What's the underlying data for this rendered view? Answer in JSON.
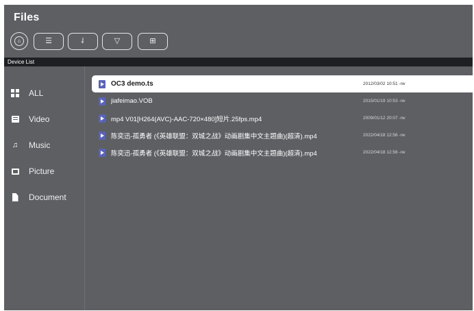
{
  "app": {
    "title": "Files"
  },
  "toolbar": {
    "home_glyph": "⌂",
    "list_glyph": "☰",
    "sort_glyph": "⇃",
    "filter_glyph": "▽",
    "grid_glyph": "⊞"
  },
  "section": {
    "label": "Device List"
  },
  "sidebar": {
    "items": [
      {
        "label": "ALL",
        "icon": "grid-icon"
      },
      {
        "label": "Video",
        "icon": "video-icon"
      },
      {
        "label": "Music",
        "icon": "music-note-icon",
        "glyph": "♫"
      },
      {
        "label": "Picture",
        "icon": "picture-icon"
      },
      {
        "label": "Document",
        "icon": "document-icon"
      }
    ]
  },
  "files": [
    {
      "name": "OC3 demo.ts",
      "date": "2012/03/02 10:51 -rw",
      "icon": "video-file-icon"
    },
    {
      "name": "jiafeimao.VOB",
      "date": "2015/01/19 10:53 -rw",
      "icon": "video-file-icon"
    },
    {
      "name": "mp4 V01[H264(AVC)-AAC-720×480]短片.25fps.mp4",
      "date": "2009/01/12 20:07 -rw",
      "icon": "video-file-icon"
    },
    {
      "name": "陈奕迅-孤勇者 (《英雄联盟：双城之战》动画剧集中文主题曲)(超清).mp4",
      "date": "2022/04/18 12:56 -rw",
      "icon": "video-file-icon"
    },
    {
      "name": "陈奕迅-孤勇者 (《英雄联盟：双城之战》动画剧集中文主题曲)(超清).mp4",
      "date": "2022/04/18 12:56 -rw",
      "icon": "video-file-icon"
    }
  ],
  "colors": {
    "background": "#5e5f63",
    "section_bar": "#1e1f22",
    "selected_row": "#ffffff",
    "file_icon": "#5a63b8"
  }
}
